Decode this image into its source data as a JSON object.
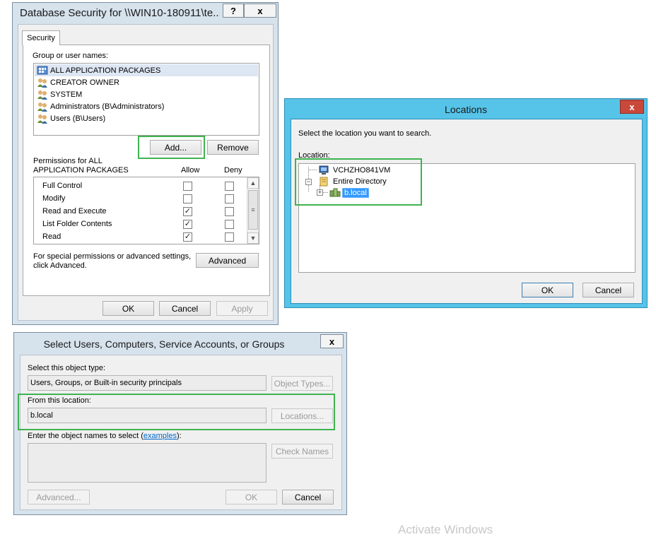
{
  "security_dialog": {
    "title": "Database Security for \\\\WIN10-180911\\te...",
    "help_glyph": "?",
    "close_glyph": "x",
    "tab": "Security",
    "group_label": "Group or user names:",
    "principals": [
      {
        "name": "ALL APPLICATION PACKAGES",
        "icon": "app-packages-icon"
      },
      {
        "name": "CREATOR OWNER",
        "icon": "users-icon"
      },
      {
        "name": "SYSTEM",
        "icon": "users-icon"
      },
      {
        "name": "Administrators (B\\Administrators)",
        "icon": "users-icon"
      },
      {
        "name": "Users (B\\Users)",
        "icon": "users-icon"
      }
    ],
    "add_label": "Add...",
    "remove_label": "Remove",
    "permissions_label_line1": "Permissions for ALL",
    "permissions_label_line2": "APPLICATION PACKAGES",
    "allow_label": "Allow",
    "deny_label": "Deny",
    "permissions": [
      {
        "name": "Full Control",
        "allow": false,
        "deny": false
      },
      {
        "name": "Modify",
        "allow": false,
        "deny": false
      },
      {
        "name": "Read and Execute",
        "allow": true,
        "deny": false
      },
      {
        "name": "List Folder Contents",
        "allow": true,
        "deny": false
      },
      {
        "name": "Read",
        "allow": true,
        "deny": false
      }
    ],
    "special_line1": "For special permissions or advanced settings,",
    "special_line2": "click Advanced.",
    "advanced_label": "Advanced",
    "ok_label": "OK",
    "cancel_label": "Cancel",
    "apply_label": "Apply"
  },
  "locations_dialog": {
    "title": "Locations",
    "close_glyph": "x",
    "instruction": "Select the location you want to search.",
    "location_label": "Location:",
    "tree": [
      {
        "label": "VCHZHO841VM",
        "icon": "computer-icon"
      },
      {
        "label": "Entire Directory",
        "icon": "folder-icon"
      },
      {
        "label": "b.local",
        "icon": "domain-icon",
        "selected": true
      }
    ],
    "ok_label": "OK",
    "cancel_label": "Cancel"
  },
  "select_dialog": {
    "title": "Select Users, Computers, Service Accounts, or Groups",
    "close_glyph": "x",
    "object_type_label": "Select this object type:",
    "object_type_value": "Users, Groups, or Built-in security principals",
    "object_types_button": "Object Types...",
    "location_label": "From this location:",
    "location_value": "b.local",
    "locations_button": "Locations...",
    "names_label": "Enter the object names to select (",
    "examples_link": "examples",
    "names_label_end": "):",
    "check_names_button": "Check Names",
    "advanced_button": "Advanced...",
    "ok_label": "OK",
    "cancel_label": "Cancel"
  },
  "watermark": "Activate Windows",
  "colors": {
    "highlight_green": "#3fb34f",
    "locations_frame": "#56c3e8",
    "selection_blue": "#3399ff",
    "link_blue": "#0066cc"
  }
}
